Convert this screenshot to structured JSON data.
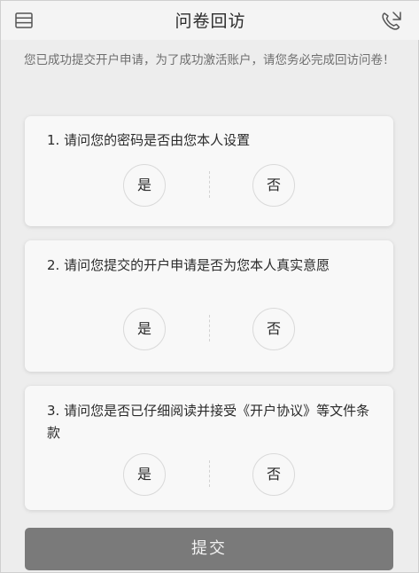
{
  "header": {
    "title": "问卷回访",
    "menu_icon": "menu-icon",
    "phone_icon": "phone-icon"
  },
  "notice": "您已成功提交开户申请，为了成功激活账户，请您务必完成回访问卷！",
  "questions": [
    {
      "text": "1. 请问您的密码是否由您本人设置",
      "yes": "是",
      "no": "否"
    },
    {
      "text": "2. 请问您提交的开户申请是否为您本人真实意愿",
      "yes": "是",
      "no": "否"
    },
    {
      "text": "3. 请问您是否已仔细阅读并接受《开户协议》等文件条款",
      "yes": "是",
      "no": "否"
    }
  ],
  "submit_label": "提交"
}
